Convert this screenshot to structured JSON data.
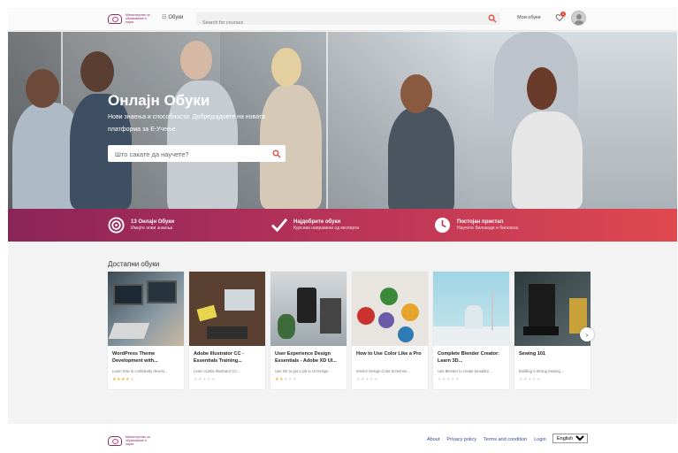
{
  "header": {
    "logo_text": "Министерство за образование и наука",
    "courses_menu": "Обуки",
    "search_placeholder": "Search for courses",
    "my_courses": "Мои обуки",
    "notifications_count": "1"
  },
  "hero": {
    "title": "Онлајн Обуки",
    "subtitle": "Нови знаења и способности. Добредојдовте на новата платформа за Е-Учење",
    "search_placeholder": "Што сакате да научете?"
  },
  "features": [
    {
      "title": "13 Онлајн Обуки",
      "subtitle": "Имајте нови знаења",
      "icon": "target-icon"
    },
    {
      "title": "Најдобрите обуки",
      "subtitle": "Курсеви направени од експерти",
      "icon": "check-icon"
    },
    {
      "title": "Постојан пристап",
      "subtitle": "Научете билокаде и билокога",
      "icon": "clock-icon"
    }
  ],
  "courses_section": {
    "title": "Достапни обуки",
    "cards": [
      {
        "title": "WordPress Theme Development with...",
        "desc": "Learn how to confidently develo...",
        "rating": 4
      },
      {
        "title": "Adobe Illustrator CC - Essentials Training...",
        "desc": "Learn Adobe Illustrator CC...",
        "rating": 0
      },
      {
        "title": "User Experience Design Essentials - Adobe XD UI...",
        "desc": "Use XD to get a job in UI Design...",
        "rating": 2
      },
      {
        "title": "How to Use Color Like a Pro",
        "desc": "Interior Design Color Schemes...",
        "rating": 0
      },
      {
        "title": "Complete Blender Creator: Learn 3D...",
        "desc": "Use Blender to create beautiful...",
        "rating": 0
      },
      {
        "title": "Sewing 101",
        "desc": "Building A Strong Sewing...",
        "rating": 0
      }
    ]
  },
  "footer": {
    "links": [
      "About",
      "Privacy policy",
      "Terms and condition",
      "Login"
    ],
    "language": "English"
  },
  "colors": {
    "accent": "#e2483c",
    "band_start": "#8a2458",
    "band_end": "#e0484f",
    "star": "#f0b429"
  }
}
